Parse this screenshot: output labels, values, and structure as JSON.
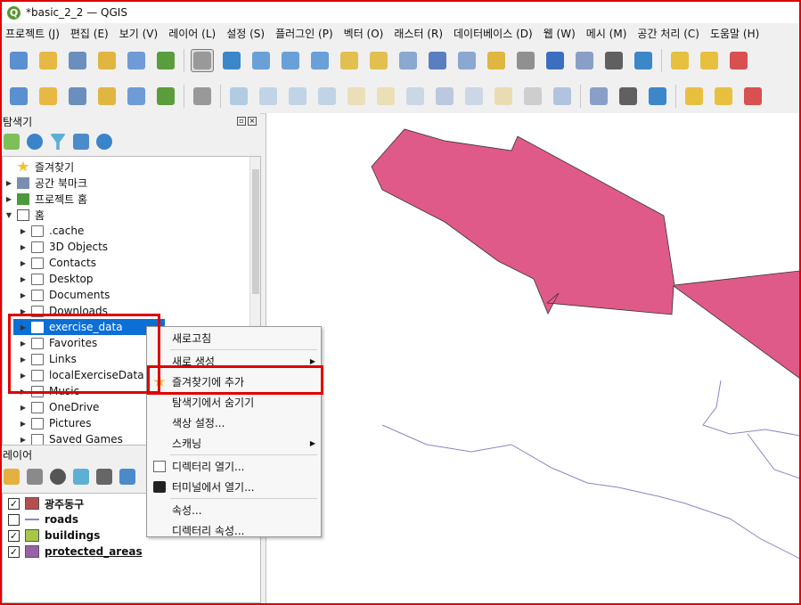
{
  "window": {
    "title": "*basic_2_2 — QGIS"
  },
  "menubar": [
    "프로젝트 (J)",
    "편집 (E)",
    "보기 (V)",
    "레이어 (L)",
    "설정 (S)",
    "플러그인 (P)",
    "벡터 (O)",
    "래스터 (R)",
    "데이터베이스 (D)",
    "웹 (W)",
    "메시 (M)",
    "공간 처리 (C)",
    "도움말 (H)"
  ],
  "toolbar1": [
    "new-project-icon",
    "open-project-icon",
    "save-project-icon",
    "print-layout-icon",
    "layout-manager-icon",
    "style-manager-icon",
    "pan-icon",
    "pan-to-selection-icon",
    "zoom-in-icon",
    "zoom-out-icon",
    "zoom-full-icon",
    "zoom-to-selection-icon",
    "zoom-to-layer-icon",
    "zoom-native-icon",
    "zoom-last-icon",
    "zoom-next-icon",
    "new-map-view-icon",
    "new-3d-view-icon",
    "new-bookmark-icon",
    "show-bookmarks-icon",
    "temporal-controller-icon",
    "refresh-icon",
    "select-features-icon",
    "attribute-table-icon",
    "deselect-icon"
  ],
  "toolbar2": [
    "data-source-manager-icon",
    "new-geopackage-icon",
    "add-vector-icon",
    "digitize-icon",
    "add-raster-icon",
    "add-wms-icon",
    "add-mesh-icon",
    "edit-pencil-icon",
    "toggle-editing-icon",
    "save-edits-icon",
    "add-feature-icon",
    "vertex-tool-icon",
    "modify-attributes-icon",
    "delete-selected-icon",
    "cut-icon",
    "copy-icon",
    "paste-icon",
    "undo-icon",
    "redo-icon",
    "label-abc-icon",
    "diagram-icon",
    "label-pin-icon",
    "label-highlight-icon",
    "label-move-icon",
    "label-rotate-icon"
  ],
  "browser_panel": {
    "title": "탐색기",
    "items": [
      {
        "label": "즐겨찾기",
        "icon": "star-icon",
        "level": 0,
        "arrow": ""
      },
      {
        "label": "공간 북마크",
        "icon": "bookmark-icon",
        "level": 0,
        "arrow": "▶"
      },
      {
        "label": "프로젝트 홈",
        "icon": "project-home-icon",
        "level": 0,
        "arrow": "▶"
      },
      {
        "label": "홈",
        "icon": "home-icon",
        "level": 0,
        "arrow": "▼"
      },
      {
        "label": ".cache",
        "icon": "folder-icon",
        "level": 1,
        "arrow": "▶"
      },
      {
        "label": "3D Objects",
        "icon": "folder-icon",
        "level": 1,
        "arrow": "▶"
      },
      {
        "label": "Contacts",
        "icon": "folder-icon",
        "level": 1,
        "arrow": "▶"
      },
      {
        "label": "Desktop",
        "icon": "folder-icon",
        "level": 1,
        "arrow": "▶"
      },
      {
        "label": "Documents",
        "icon": "folder-icon",
        "level": 1,
        "arrow": "▶"
      },
      {
        "label": "Downloads",
        "icon": "folder-icon",
        "level": 1,
        "arrow": "▶"
      },
      {
        "label": "exercise_data",
        "icon": "folder-icon",
        "level": 1,
        "arrow": "▶",
        "selected": true
      },
      {
        "label": "Favorites",
        "icon": "folder-icon",
        "level": 1,
        "arrow": "▶"
      },
      {
        "label": "Links",
        "icon": "folder-icon",
        "level": 1,
        "arrow": "▶"
      },
      {
        "label": "localExerciseData",
        "icon": "folder-icon",
        "level": 1,
        "arrow": "▶"
      },
      {
        "label": "Music",
        "icon": "folder-icon",
        "level": 1,
        "arrow": "▶"
      },
      {
        "label": "OneDrive",
        "icon": "folder-icon",
        "level": 1,
        "arrow": "▶"
      },
      {
        "label": "Pictures",
        "icon": "folder-icon",
        "level": 1,
        "arrow": "▶"
      },
      {
        "label": "Saved Games",
        "icon": "folder-icon",
        "level": 1,
        "arrow": "▶"
      }
    ]
  },
  "layers_panel": {
    "title": "레이어",
    "layers": [
      {
        "name": "광주동구",
        "symbol": "fill",
        "color": "#b54e4e",
        "checked": true
      },
      {
        "name": "roads",
        "symbol": "line",
        "color": "#8a84c8",
        "checked": false
      },
      {
        "name": "buildings",
        "symbol": "fill",
        "color": "#a8c74a",
        "checked": true
      },
      {
        "name": "protected_areas",
        "symbol": "fill",
        "color": "#9b5fa8",
        "checked": true,
        "underlined": true
      }
    ]
  },
  "context_menu": {
    "items": [
      {
        "label": "새로고침",
        "type": "item"
      },
      {
        "type": "separator"
      },
      {
        "label": "새로 생성",
        "type": "submenu"
      },
      {
        "label": "즐겨찾기에 추가",
        "type": "item",
        "icon": "star-icon",
        "highlighted": true
      },
      {
        "label": "탐색기에서 숨기기",
        "type": "item"
      },
      {
        "label": "색상 설정...",
        "type": "item"
      },
      {
        "label": "스캐닝",
        "type": "submenu"
      },
      {
        "type": "separator"
      },
      {
        "label": "디렉터리 열기...",
        "type": "item",
        "icon": "folder-icon"
      },
      {
        "label": "터미널에서 열기...",
        "type": "item",
        "icon": "terminal-icon"
      },
      {
        "type": "separator"
      },
      {
        "label": "속성...",
        "type": "item"
      },
      {
        "label": "디렉터리 속성...",
        "type": "item"
      }
    ]
  },
  "map": {
    "polygon_color": "#e05a89",
    "line_color": "#8a84c8"
  }
}
